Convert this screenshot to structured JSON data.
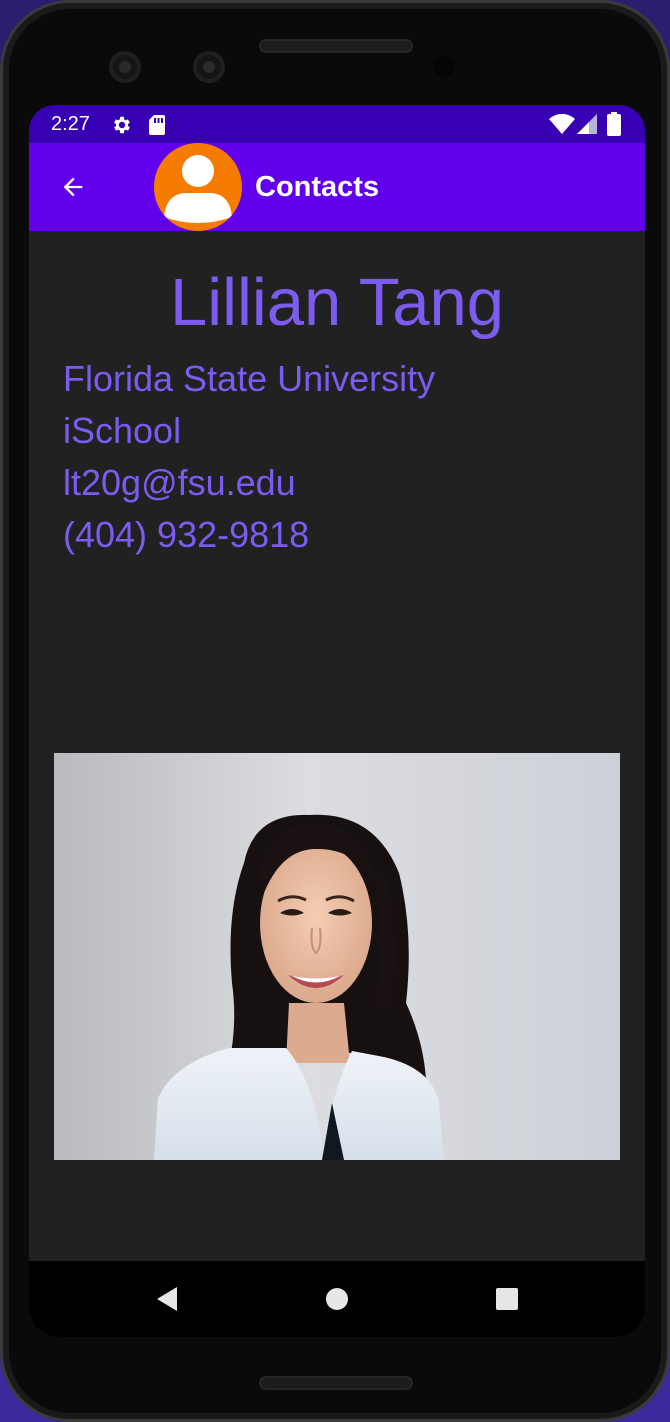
{
  "status_bar": {
    "time": "2:27",
    "icons": [
      "settings-icon",
      "sd-card-icon",
      "wifi-icon",
      "signal-icon",
      "battery-icon"
    ]
  },
  "app_bar": {
    "title": "Contacts",
    "back_icon": "arrow-back-icon",
    "avatar_icon": "person-avatar-icon",
    "background": "#6200ee",
    "status_background": "#3700b3",
    "avatar_color": "#f57c00"
  },
  "contact": {
    "name": "Lillian Tang",
    "organization": "Florida State University",
    "department": "iSchool",
    "email": "lt20g@fsu.edu",
    "phone": "(404) 932-9818",
    "text_color": "#7c5cf0"
  },
  "photo": {
    "description_icon": "contact-photo"
  },
  "nav_bar": {
    "icons": [
      "back-triangle-icon",
      "home-circle-icon",
      "recents-square-icon"
    ]
  }
}
